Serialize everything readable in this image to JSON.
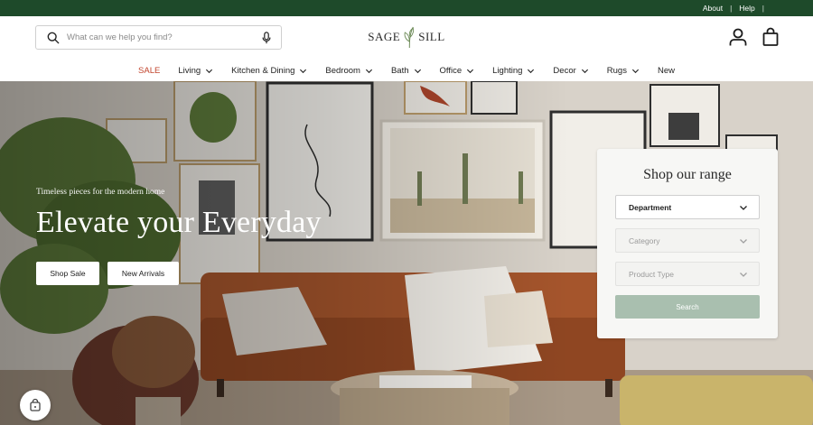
{
  "utility": {
    "about": "About",
    "separator": "|",
    "help": "Help"
  },
  "header": {
    "search_placeholder": "What can we help you find?",
    "logo_left": "SAGE",
    "logo_right": "SILL"
  },
  "nav": {
    "sale": "SALE",
    "items": [
      "Living",
      "Kitchen & Dining",
      "Bedroom",
      "Bath",
      "Office",
      "Lighting",
      "Decor",
      "Rugs"
    ],
    "new": "New"
  },
  "hero": {
    "subtitle": "Timeless pieces for the modern home",
    "title": "Elevate your Everyday",
    "btn_shop_sale": "Shop Sale",
    "btn_new_arrivals": "New Arrivals"
  },
  "range_panel": {
    "title": "Shop our range",
    "department": "Department",
    "category": "Category",
    "product_type": "Product Type",
    "search": "Search"
  },
  "colors": {
    "utility_bar": "#1e4a2a",
    "sale_red": "#c2452d",
    "search_button": "#a9bfaf"
  },
  "icons": {
    "search": "search-icon",
    "mic": "microphone-icon",
    "account": "user-icon",
    "bag": "shopping-bag-icon",
    "chevron": "chevron-down-icon",
    "chat": "chat-bag-icon",
    "logo_leaf": "leaf-icon"
  }
}
